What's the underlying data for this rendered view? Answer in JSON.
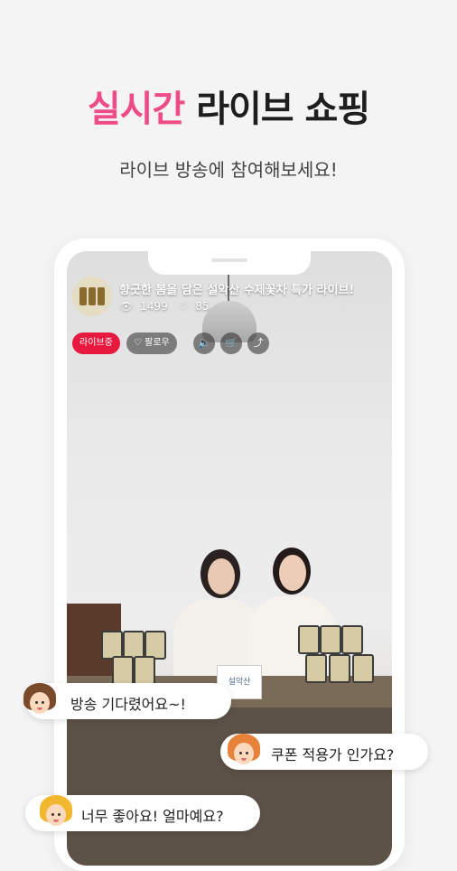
{
  "headline": {
    "accent": "실시간",
    "rest": " 라이브 쇼핑"
  },
  "subheadline": "라이브 방송에 참여해보세요!",
  "live": {
    "title": "향긋한 봄을 담은 설악산 수제꽃차 특가 라이브!",
    "viewers": "1499",
    "likes": "85",
    "badge": "라이브중",
    "follow_label": "팔로우",
    "sign_text": "설악산"
  },
  "chat": [
    {
      "text": "방송 기다렸어요~!",
      "avatar": "girl-avatar-icon"
    },
    {
      "text": "쿠폰 적용가 인가요?",
      "avatar": "woman-avatar-icon"
    },
    {
      "text": "너무 좋아요! 얼마예요?",
      "avatar": "child-avatar-icon"
    }
  ],
  "colors": {
    "accent": "#ef4b86",
    "live_red": "#e8193f",
    "background": "#f4f4f5"
  }
}
